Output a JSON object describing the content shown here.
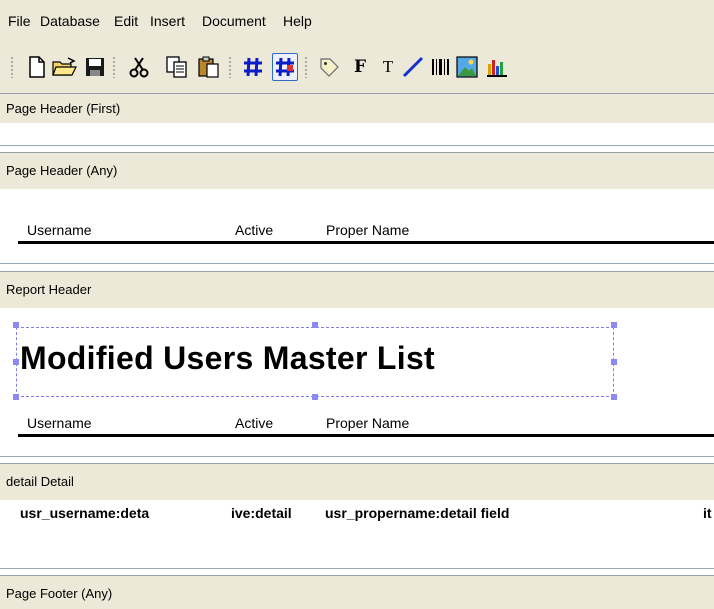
{
  "menu": [
    "File",
    "Database",
    "Edit",
    "Insert",
    "Document",
    "Help"
  ],
  "toolbar": {
    "buttons": [
      "new-icon",
      "open-folder-icon",
      "save-icon",
      "cut-icon",
      "copy-icon",
      "paste-icon",
      "grid-icon",
      "snap-to-grid-icon",
      "tag-icon",
      "bold-field-icon",
      "text-icon",
      "line-icon",
      "barcode-icon",
      "image-icon",
      "chart-icon"
    ],
    "bold_glyph": "F",
    "text_glyph": "T"
  },
  "bands": {
    "page_header_first": "Page Header (First)",
    "page_header_any": "Page Header (Any)",
    "report_header": "Report Header",
    "detail": "detail Detail",
    "page_footer_any": "Page Footer (Any)"
  },
  "columns": {
    "username": "Username",
    "active": "Active",
    "proper_name": "Proper Name"
  },
  "report_title": "Modified Users Master List",
  "detail_fields": {
    "username": "usr_username:deta",
    "active": "ive:detail",
    "proper_name": "usr_propername:detail field",
    "clipped": "it"
  },
  "colors": {
    "chrome": "#ece9d8",
    "selection": "#8a8af2",
    "pressed_border": "#3169c6"
  }
}
